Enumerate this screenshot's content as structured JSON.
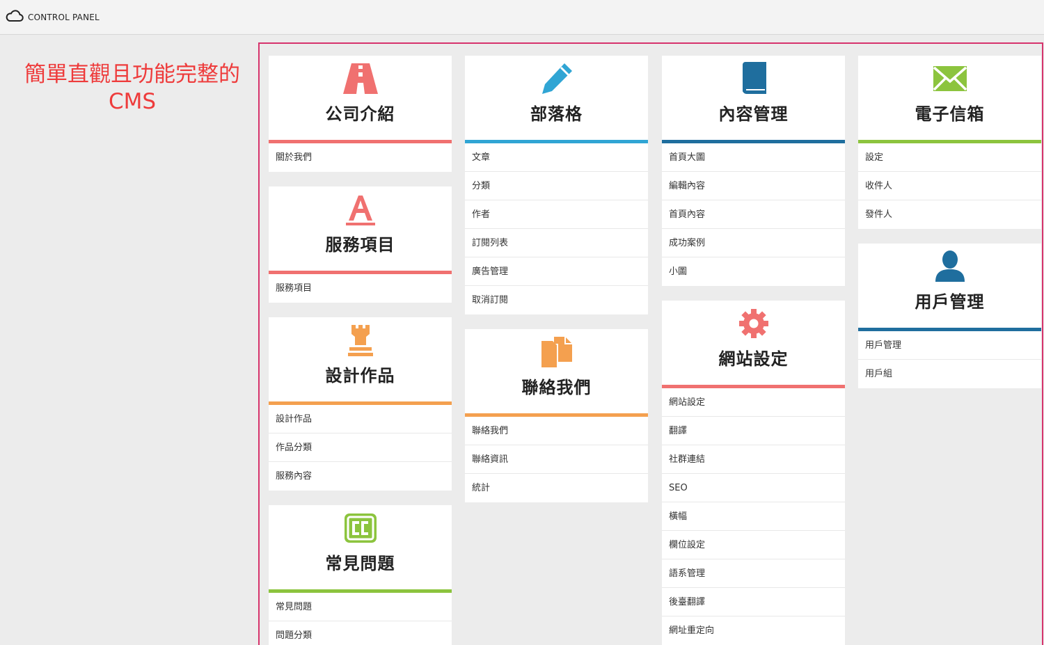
{
  "header": {
    "brand": "CONTROL PANEL",
    "icon": "cloud-icon"
  },
  "tagline": {
    "line1": "簡單直觀且功能完整的",
    "line2": "CMS"
  },
  "columns": [
    [
      {
        "title": "公司介紹",
        "icon": "road-icon",
        "color": "#f07170",
        "items": [
          "關於我們"
        ]
      },
      {
        "title": "服務項目",
        "icon": "font-a-icon",
        "color": "#f07170",
        "items": [
          "服務項目"
        ]
      },
      {
        "title": "設計作品",
        "icon": "rook-icon",
        "color": "#f4a04f",
        "items": [
          "設計作品",
          "作品分類",
          "服務內容"
        ]
      },
      {
        "title": "常見問題",
        "icon": "cc-icon",
        "color": "#8cc43e",
        "items": [
          "常見問題",
          "問題分類"
        ]
      }
    ],
    [
      {
        "title": "部落格",
        "icon": "pencil-icon",
        "color": "#30a5d4",
        "items": [
          "文章",
          "分類",
          "作者",
          "訂閱列表",
          "廣告管理",
          "取消訂閱"
        ]
      },
      {
        "title": "聯絡我們",
        "icon": "files-icon",
        "color": "#f4a04f",
        "items": [
          "聯絡我們",
          "聯絡資訊",
          "統計"
        ]
      }
    ],
    [
      {
        "title": "內容管理",
        "icon": "book-icon",
        "color": "#1f6e9e",
        "items": [
          "首頁大圖",
          "編輯內容",
          "首頁內容",
          "成功案例",
          "小圖"
        ]
      },
      {
        "title": "網站設定",
        "icon": "gear-icon",
        "color": "#f07170",
        "items": [
          "網站設定",
          "翻譯",
          "社群連結",
          "SEO",
          "橫幅",
          "欄位設定",
          "語系管理",
          "後臺翻譯",
          "網址重定向"
        ]
      }
    ],
    [
      {
        "title": "電子信箱",
        "icon": "envelope-icon",
        "color": "#8cc43e",
        "items": [
          "設定",
          "收件人",
          "發件人"
        ]
      },
      {
        "title": "用戶管理",
        "icon": "user-icon",
        "color": "#1f6e9e",
        "items": [
          "用戶管理",
          "用戶組"
        ]
      }
    ]
  ]
}
